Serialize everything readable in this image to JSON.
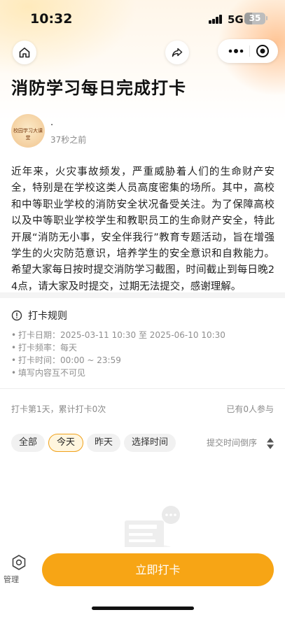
{
  "status_bar": {
    "time": "10:32",
    "network": "5G",
    "battery": "35",
    "battery_level_percent": 35
  },
  "nav": {
    "home_icon": "home-icon",
    "share_icon": "share-icon",
    "more_icon": "more-dots-icon",
    "target_icon": "close-target-icon"
  },
  "page": {
    "title": "消防学习每日完成打卡"
  },
  "author": {
    "avatar_text": "校园学习大课堂",
    "name": ".",
    "time": "37秒之前"
  },
  "content": {
    "body": "近年来，火灾事故频发，严重威胁着人们的生命财产安全，特别是在学校这类人员高度密集的场所。其中，高校和中等职业学校的消防安全状况备受关注。为了保障高校以及中等职业学校学生和教职员工的生命财产安全，特此开展“消防无小事，安全伴我行”教育专题活动，旨在增强学生的火灾防范意识，培养学生的安全意识和自救能力。希望大家每日按时提交消防学习截图，时间截止到每日晚24点，请大家及时提交，过期无法提交，感谢理解。"
  },
  "rules": {
    "title": "打卡规则",
    "date_label": "打卡日期：",
    "date_value": "2025-03-11 10:30 至 2025-06-10 10:30",
    "freq_label": "打卡频率：",
    "freq_value": "每天",
    "time_label": "打卡时间：",
    "time_value": "00:00 ~ 23:59",
    "note": "填写内容互不可见"
  },
  "stats": {
    "summary": "打卡第1天，累计打卡0次",
    "participants": "已有0人参与"
  },
  "filters": {
    "all": "全部",
    "today": "今天",
    "yesterday": "昨天",
    "pick_time": "选择时间",
    "sort_label": "提交时间倒序"
  },
  "bottom": {
    "manage_label": "管理",
    "cta_label": "立即打卡"
  },
  "colors": {
    "accent": "#f7a515",
    "chip_active_border": "#f0a11b"
  }
}
